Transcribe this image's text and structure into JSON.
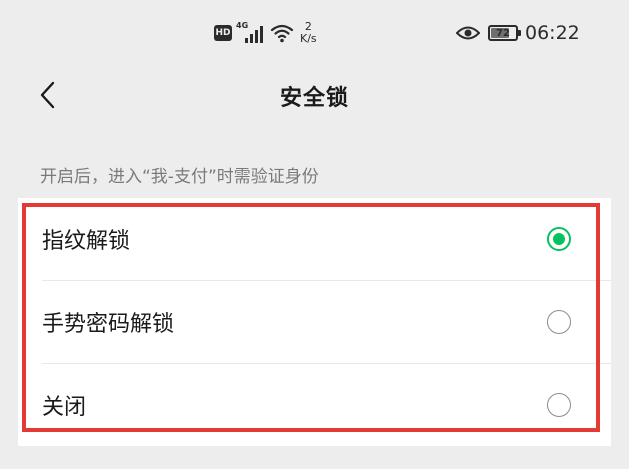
{
  "status_bar": {
    "hd_label": "HD",
    "network_type": "4G",
    "speed_value": "2",
    "speed_unit": "K/s",
    "battery_level": "72",
    "time": "06:22",
    "icons": [
      "hd-icon",
      "signal-icon",
      "wifi-icon",
      "eye-icon",
      "battery-icon"
    ]
  },
  "nav": {
    "title": "安全锁",
    "back_icon": "chevron-left-icon"
  },
  "hint": "开启后，进入“我-支付”时需验证身份",
  "options": [
    {
      "label": "指纹解锁",
      "selected": true
    },
    {
      "label": "手势密码解锁",
      "selected": false
    },
    {
      "label": "关闭",
      "selected": false
    }
  ],
  "colors": {
    "accent": "#07c160",
    "highlight": "#e53935",
    "background": "#ededed"
  }
}
